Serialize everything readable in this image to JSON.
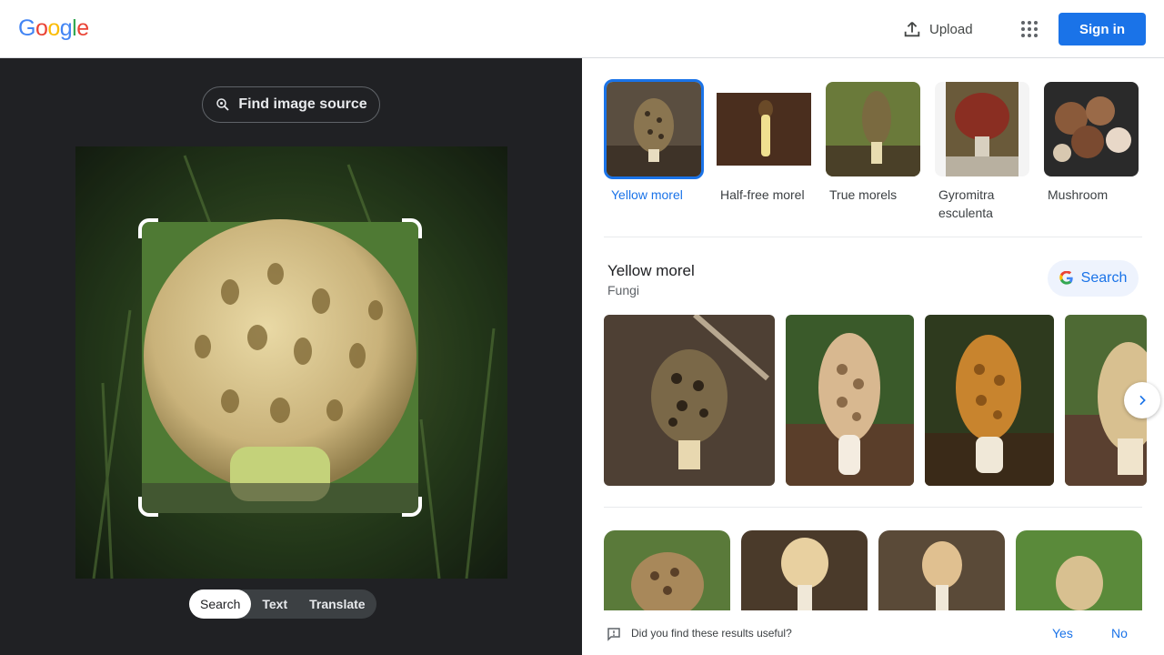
{
  "header": {
    "logo_letters": [
      {
        "ch": "G",
        "color": "#4285F4"
      },
      {
        "ch": "o",
        "color": "#EA4335"
      },
      {
        "ch": "o",
        "color": "#FBBC05"
      },
      {
        "ch": "g",
        "color": "#4285F4"
      },
      {
        "ch": "l",
        "color": "#34A853"
      },
      {
        "ch": "e",
        "color": "#EA4335"
      }
    ],
    "upload_label": "Upload",
    "signin_label": "Sign in"
  },
  "lens": {
    "find_source_label": "Find image source",
    "modes": [
      {
        "label": "Search",
        "active": true
      },
      {
        "label": "Text",
        "active": false
      },
      {
        "label": "Translate",
        "active": false
      }
    ]
  },
  "chips": [
    {
      "label": "Yellow morel",
      "selected": true
    },
    {
      "label": "Half-free morel",
      "selected": false
    },
    {
      "label": "True morels",
      "selected": false
    },
    {
      "label": "Gyromitra esculenta",
      "selected": false
    },
    {
      "label": "Mushroom",
      "selected": false
    }
  ],
  "entity": {
    "title": "Yellow morel",
    "subtitle": "Fungi",
    "search_label": "Search"
  },
  "feedback": {
    "question": "Did you find these results useful?",
    "yes": "Yes",
    "no": "No"
  },
  "colors": {
    "accent": "#1a73e8",
    "dark_panel": "#202124"
  }
}
